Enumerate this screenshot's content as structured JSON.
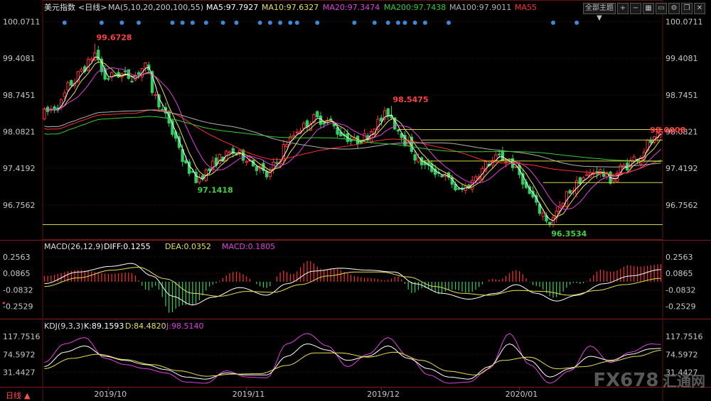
{
  "header": {
    "symbol": "美元指数",
    "period_tag": "<日线>",
    "ma_params": "MA(5,10,20,200,100,55)",
    "ma_values": [
      {
        "label": "MA5:97.7927",
        "color": "#ffffff"
      },
      {
        "label": "MA10:97.6327",
        "color": "#e8e050"
      },
      {
        "label": "MA20:97.3474",
        "color": "#e040e0"
      },
      {
        "label": "MA200:97.7438",
        "color": "#30d030"
      },
      {
        "label": "MA100:97.9011",
        "color": "#b0b0b0"
      },
      {
        "label": "MA55",
        "color": "#ff3030"
      }
    ],
    "dropdown_label": "全部主题",
    "dropdown_arrow": "▼"
  },
  "price_axis": {
    "ticks": [
      100.0711,
      99.4081,
      98.7451,
      98.0821,
      97.4192,
      96.7562
    ],
    "tick_labels": [
      "100.0711",
      "99.4081",
      "98.7451",
      "98.0821",
      "97.4192",
      "96.7562"
    ],
    "range": [
      96.15,
      100.18
    ]
  },
  "annotations": [
    {
      "text": "99.6728",
      "value": 99.6728,
      "bar": 15,
      "color": "#ff4040"
    },
    {
      "text": "97.1418",
      "value": 97.1418,
      "bar": 45,
      "color": "#40d040"
    },
    {
      "text": "98.5475",
      "value": 98.5475,
      "bar": 103,
      "color": "#ff4040"
    },
    {
      "text": "96.3534",
      "value": 96.3534,
      "bar": 150,
      "color": "#40d040"
    },
    {
      "text": "98.0008",
      "value": 98.0008,
      "bar": 181,
      "color": "#ff4040"
    }
  ],
  "horizontal_levels": [
    {
      "value": 98.12,
      "from_bar": 105,
      "color": "#d4d44a"
    },
    {
      "value": 97.93,
      "from_bar": 112,
      "color": "#d4d44a"
    },
    {
      "value": 97.55,
      "from_bar": 112,
      "color": "#d4d44a"
    },
    {
      "value": 97.16,
      "from_bar": 148,
      "color": "#d4d44a"
    },
    {
      "value": 96.4,
      "from_bar": 0,
      "color": "#d4d44a"
    }
  ],
  "event_markers": [
    6,
    17,
    23,
    28,
    38,
    41,
    44,
    48,
    53,
    57,
    64,
    67,
    70,
    73,
    75,
    81,
    92,
    98,
    102,
    105,
    107,
    110,
    113,
    120,
    151,
    158
  ],
  "macd": {
    "label": "MACD(26,12,9)",
    "diff_label": "DIFF:0.1255",
    "dea_label": "DEA:0.0352",
    "macd_label": "MACD:0.1805",
    "diff_color": "#ffffff",
    "dea_color": "#e8e050",
    "macd_color": "#e040e0",
    "ticks": [
      0.2563,
      0.0865,
      -0.0832,
      -0.2529
    ],
    "tick_labels": [
      "0.2563",
      "0.0865",
      "-0.0832",
      "-0.2529"
    ],
    "range": [
      -0.36,
      0.33
    ]
  },
  "kdj": {
    "label": "KDJ(9,3,3)",
    "k_label": "K:89.1593",
    "d_label": "D:84.4820",
    "j_label": "J:98.5140",
    "k_color": "#ffffff",
    "d_color": "#e8e050",
    "j_color": "#e040e0",
    "ticks": [
      117.7516,
      74.5972,
      31.4427
    ],
    "tick_labels": [
      "117.7516",
      "74.5972",
      "31.4427"
    ],
    "range": [
      5,
      135
    ]
  },
  "time_axis": {
    "labels": [
      {
        "text": "2019/10",
        "bar": 19
      },
      {
        "text": "2019/11",
        "bar": 60
      },
      {
        "text": "2019/12",
        "bar": 100
      },
      {
        "text": "2020/01",
        "bar": 141
      }
    ],
    "period_button": "日线"
  },
  "watermark": {
    "text": "FX678",
    "cn": "汇通网"
  },
  "colors": {
    "up": "#ff3030",
    "down": "#30d060",
    "grid": "#5a1010",
    "axis_text": "#c8c8c8"
  },
  "chart_data": {
    "type": "candlestick",
    "title": "美元指数 <日线>",
    "bar_count": 184,
    "close_series_knots": [
      [
        0,
        98.42
      ],
      [
        4,
        98.55
      ],
      [
        8,
        98.95
      ],
      [
        12,
        99.25
      ],
      [
        15,
        99.5
      ],
      [
        18,
        99.05
      ],
      [
        22,
        99.12
      ],
      [
        26,
        99.08
      ],
      [
        30,
        99.25
      ],
      [
        33,
        98.7
      ],
      [
        36,
        98.35
      ],
      [
        39,
        97.95
      ],
      [
        42,
        97.45
      ],
      [
        45,
        97.22
      ],
      [
        48,
        97.35
      ],
      [
        52,
        97.6
      ],
      [
        56,
        97.7
      ],
      [
        60,
        97.62
      ],
      [
        63,
        97.45
      ],
      [
        66,
        97.28
      ],
      [
        69,
        97.52
      ],
      [
        72,
        97.9
      ],
      [
        76,
        98.15
      ],
      [
        80,
        98.32
      ],
      [
        84,
        98.28
      ],
      [
        88,
        98.05
      ],
      [
        92,
        97.9
      ],
      [
        95,
        97.98
      ],
      [
        99,
        98.25
      ],
      [
        102,
        98.42
      ],
      [
        105,
        98.12
      ],
      [
        108,
        97.85
      ],
      [
        111,
        97.55
      ],
      [
        114,
        97.42
      ],
      [
        117,
        97.35
      ],
      [
        120,
        97.2
      ],
      [
        123,
        97.0
      ],
      [
        126,
        97.12
      ],
      [
        129,
        97.35
      ],
      [
        132,
        97.52
      ],
      [
        135,
        97.62
      ],
      [
        138,
        97.55
      ],
      [
        141,
        97.3
      ],
      [
        144,
        96.95
      ],
      [
        147,
        96.65
      ],
      [
        150,
        96.45
      ],
      [
        153,
        96.68
      ],
      [
        156,
        97.02
      ],
      [
        160,
        97.25
      ],
      [
        164,
        97.38
      ],
      [
        168,
        97.22
      ],
      [
        172,
        97.45
      ],
      [
        176,
        97.62
      ],
      [
        180,
        97.9
      ],
      [
        183,
        98.0
      ]
    ],
    "macd_knots": [
      [
        0,
        -0.02
      ],
      [
        10,
        0.1
      ],
      [
        20,
        0.16
      ],
      [
        26,
        0.19
      ],
      [
        32,
        0.06
      ],
      [
        38,
        -0.15
      ],
      [
        44,
        -0.24
      ],
      [
        50,
        -0.16
      ],
      [
        58,
        -0.06
      ],
      [
        66,
        -0.14
      ],
      [
        72,
        -0.02
      ],
      [
        80,
        0.11
      ],
      [
        88,
        0.14
      ],
      [
        96,
        0.12
      ],
      [
        104,
        0.1
      ],
      [
        110,
        -0.02
      ],
      [
        118,
        -0.12
      ],
      [
        126,
        -0.18
      ],
      [
        134,
        -0.12
      ],
      [
        140,
        -0.03
      ],
      [
        146,
        -0.12
      ],
      [
        152,
        -0.2
      ],
      [
        158,
        -0.14
      ],
      [
        166,
        -0.02
      ],
      [
        174,
        0.06
      ],
      [
        183,
        0.1255
      ]
    ],
    "dea_knots": [
      [
        0,
        -0.05
      ],
      [
        10,
        0.04
      ],
      [
        20,
        0.12
      ],
      [
        28,
        0.15
      ],
      [
        36,
        0.03
      ],
      [
        44,
        -0.12
      ],
      [
        52,
        -0.15
      ],
      [
        60,
        -0.1
      ],
      [
        68,
        -0.11
      ],
      [
        76,
        -0.03
      ],
      [
        84,
        0.06
      ],
      [
        92,
        0.1
      ],
      [
        100,
        0.1
      ],
      [
        108,
        0.05
      ],
      [
        116,
        -0.05
      ],
      [
        124,
        -0.12
      ],
      [
        132,
        -0.14
      ],
      [
        140,
        -0.09
      ],
      [
        148,
        -0.1
      ],
      [
        156,
        -0.14
      ],
      [
        164,
        -0.09
      ],
      [
        172,
        -0.03
      ],
      [
        183,
        0.0352
      ]
    ],
    "kdj_k_knots": [
      [
        0,
        45
      ],
      [
        6,
        80
      ],
      [
        12,
        95
      ],
      [
        18,
        70
      ],
      [
        24,
        60
      ],
      [
        30,
        50
      ],
      [
        36,
        38
      ],
      [
        42,
        20
      ],
      [
        48,
        15
      ],
      [
        54,
        30
      ],
      [
        60,
        25
      ],
      [
        66,
        25
      ],
      [
        72,
        70
      ],
      [
        78,
        100
      ],
      [
        84,
        85
      ],
      [
        90,
        60
      ],
      [
        96,
        70
      ],
      [
        102,
        95
      ],
      [
        108,
        65
      ],
      [
        114,
        40
      ],
      [
        120,
        20
      ],
      [
        126,
        15
      ],
      [
        132,
        45
      ],
      [
        138,
        100
      ],
      [
        144,
        60
      ],
      [
        150,
        20
      ],
      [
        156,
        40
      ],
      [
        162,
        70
      ],
      [
        168,
        60
      ],
      [
        174,
        75
      ],
      [
        180,
        88
      ],
      [
        183,
        89.16
      ]
    ],
    "kdj_d_knots": [
      [
        0,
        40
      ],
      [
        8,
        65
      ],
      [
        16,
        75
      ],
      [
        24,
        62
      ],
      [
        32,
        50
      ],
      [
        40,
        35
      ],
      [
        48,
        22
      ],
      [
        56,
        27
      ],
      [
        64,
        28
      ],
      [
        72,
        48
      ],
      [
        80,
        78
      ],
      [
        88,
        78
      ],
      [
        96,
        68
      ],
      [
        104,
        80
      ],
      [
        112,
        60
      ],
      [
        120,
        34
      ],
      [
        128,
        25
      ],
      [
        136,
        60
      ],
      [
        144,
        68
      ],
      [
        152,
        40
      ],
      [
        160,
        45
      ],
      [
        168,
        58
      ],
      [
        176,
        70
      ],
      [
        183,
        84.48
      ]
    ],
    "kdj_j_knots": [
      [
        0,
        55
      ],
      [
        6,
        100
      ],
      [
        12,
        115
      ],
      [
        18,
        65
      ],
      [
        24,
        50
      ],
      [
        30,
        40
      ],
      [
        36,
        30
      ],
      [
        42,
        8
      ],
      [
        48,
        5
      ],
      [
        54,
        35
      ],
      [
        60,
        20
      ],
      [
        66,
        18
      ],
      [
        72,
        100
      ],
      [
        78,
        125
      ],
      [
        84,
        95
      ],
      [
        90,
        45
      ],
      [
        96,
        75
      ],
      [
        102,
        115
      ],
      [
        108,
        70
      ],
      [
        114,
        25
      ],
      [
        120,
        5
      ],
      [
        126,
        8
      ],
      [
        132,
        40
      ],
      [
        138,
        125
      ],
      [
        144,
        50
      ],
      [
        150,
        5
      ],
      [
        156,
        35
      ],
      [
        162,
        95
      ],
      [
        168,
        55
      ],
      [
        174,
        80
      ],
      [
        180,
        100
      ],
      [
        183,
        98.51
      ]
    ],
    "moving_averages": [
      {
        "name": "MA5",
        "color": "#ffffff",
        "smooth": 2
      },
      {
        "name": "MA10",
        "color": "#e8e050",
        "smooth": 5
      },
      {
        "name": "MA20",
        "color": "#e040e0",
        "smooth": 10
      },
      {
        "name": "MA55",
        "color": "#ff3030",
        "smooth": 27
      },
      {
        "name": "MA100",
        "color": "#b0b0b0",
        "smooth": 50
      },
      {
        "name": "MA200",
        "color": "#30d030",
        "smooth": 80
      }
    ]
  }
}
